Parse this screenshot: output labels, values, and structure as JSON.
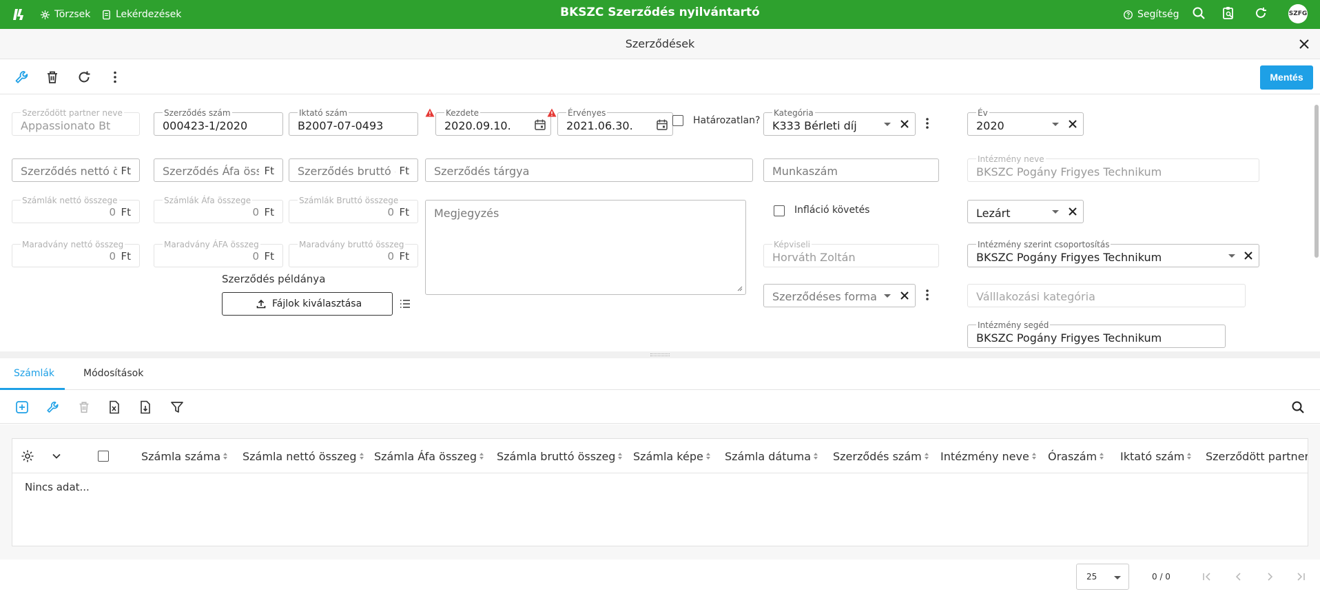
{
  "topbar": {
    "title": "BKSZC Szerződés nyilvántartó",
    "nav": [
      {
        "label": "Törzsek",
        "icon": "hub-icon"
      },
      {
        "label": "Lekérdezések",
        "icon": "document-icon"
      }
    ],
    "help_label": "Segítség",
    "avatar": "SZFG",
    "bg_color": "#2ea12e"
  },
  "subheader": {
    "title": "Szerződések"
  },
  "toolbar": {
    "save_label": "Mentés",
    "accent": "#1ea0e6"
  },
  "form": {
    "partner": {
      "label": "Szerződött partner neve",
      "value": "Appassionato Bt"
    },
    "contract_no": {
      "label": "Szerződés szám",
      "value": "000423-1/2020"
    },
    "filing_no": {
      "label": "Iktató szám",
      "value": "B2007-07-0493"
    },
    "start": {
      "label": "Kezdete",
      "value": "2020.09.10."
    },
    "valid": {
      "label": "Érvényes",
      "value": "2021.06.30."
    },
    "indefinite_label": "Határozatlan?",
    "category": {
      "label": "Kategória",
      "value": "K333 Bérleti díj"
    },
    "year": {
      "label": "Év",
      "value": "2020"
    },
    "net_placeholder": "Szerződés nettó össz",
    "vat_placeholder": "Szerződés Áfa össz",
    "gross_placeholder": "Szerződés bruttó öss",
    "currency": "Ft",
    "subject_placeholder": "Szerződés tárgya",
    "work_no_placeholder": "Munkaszám",
    "institution": {
      "label": "Intézmény neve",
      "value": "BKSZC Pogány Frigyes Technikum"
    },
    "inv_net": {
      "label": "Számlák nettó összege",
      "value": "0"
    },
    "inv_vat": {
      "label": "Számlák Áfa összege",
      "value": "0"
    },
    "inv_gross": {
      "label": "Számlák Bruttó összege",
      "value": "0"
    },
    "note_placeholder": "Megjegyzés",
    "inflation_label": "Infláció követés",
    "status_value": "Lezárt",
    "rem_net": {
      "label": "Maradvány nettó összeg",
      "value": "0"
    },
    "rem_vat": {
      "label": "Maradvány ÁFA összeg",
      "value": "0"
    },
    "rem_gross": {
      "label": "Maradvány bruttó összeg",
      "value": "0"
    },
    "representative": {
      "label": "Képviseli",
      "value": "Horváth Zoltán"
    },
    "group_by_inst": {
      "label": "Intézmény szerint csoportosítás",
      "value": "BKSZC Pogány Frigyes Technikum"
    },
    "copy_label": "Szerződés példánya",
    "file_button": "Fájlok kiválasztása",
    "contract_form_placeholder": "Szerződéses forma",
    "business_cat_placeholder": "Válllakozási kategória",
    "inst_helper": {
      "label": "Intézmény segéd",
      "value": "BKSZC Pogány Frigyes Technikum"
    }
  },
  "tabs": [
    {
      "label": "Számlák",
      "active": true
    },
    {
      "label": "Módosítások",
      "active": false
    }
  ],
  "grid": {
    "columns": [
      "Számla száma",
      "Számla nettó összeg",
      "Számla Áfa összeg",
      "Számla bruttó összeg",
      "Számla képe",
      "Számla dátuma",
      "Szerződés szám",
      "Intézmény neve",
      "Óraszám",
      "Iktató szám",
      "Szerződött partner n"
    ],
    "empty_text": "Nincs adat..."
  },
  "pager": {
    "page_size": "25",
    "info": "0 / 0"
  }
}
